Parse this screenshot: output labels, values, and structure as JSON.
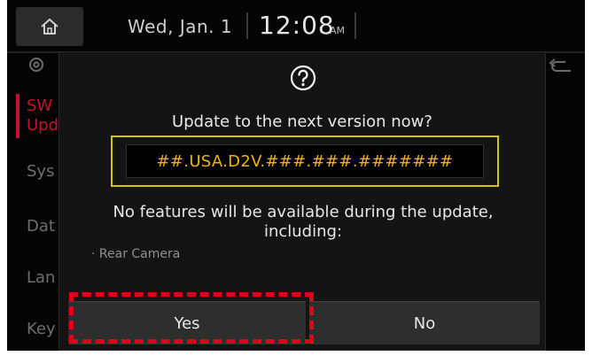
{
  "status_bar": {
    "home_icon": "home-icon",
    "date": "Wed, Jan. 1",
    "time": "12:08",
    "ampm": "AM"
  },
  "background_sidebar": {
    "gear_icon": "gear-icon",
    "back_icon": "back-arrow-icon",
    "items": [
      "SW",
      "Upd",
      "Sys",
      "Dat",
      "Lan",
      "Key"
    ],
    "accent_color": "#c8102e"
  },
  "dialog": {
    "icon": "question-icon",
    "question": "Update to the next version now?",
    "version": "##.USA.D2V.###.###.#######",
    "notice_line1": "No features will be available during the update,",
    "notice_line2": "including:",
    "features": [
      "· Rear Camera"
    ],
    "yes_label": "Yes",
    "no_label": "No",
    "accent_version_color": "#f2b400",
    "version_box_color": "#d6c400",
    "highlight_color": "#e1001a"
  }
}
